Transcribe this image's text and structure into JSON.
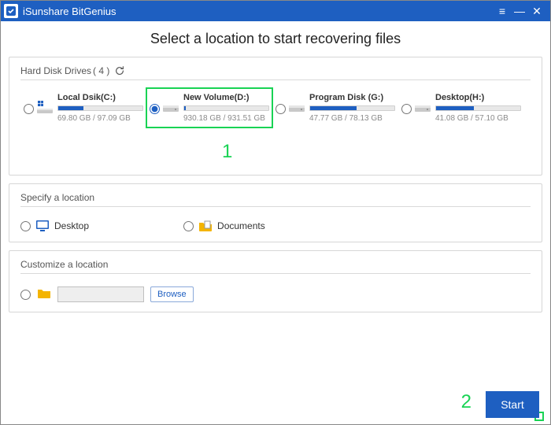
{
  "app": {
    "title": "iSunshare BitGenius"
  },
  "page": {
    "title": "Select a location to start recovering files"
  },
  "hdd": {
    "label": "Hard Disk Drives",
    "count_fmt": "( 4 )",
    "drives": [
      {
        "name": "Local Dsik(C:)",
        "size": "69.80 GB / 97.09 GB",
        "pct": 30,
        "selected": false,
        "os": true
      },
      {
        "name": "New Volume(D:)",
        "size": "930.18 GB / 931.51 GB",
        "pct": 2,
        "selected": true,
        "os": false
      },
      {
        "name": "Program Disk (G:)",
        "size": "47.77 GB / 78.13 GB",
        "pct": 55,
        "selected": false,
        "os": false
      },
      {
        "name": "Desktop(H:)",
        "size": "41.08 GB / 57.10 GB",
        "pct": 45,
        "selected": false,
        "os": false
      }
    ]
  },
  "specify": {
    "label": "Specify a location",
    "desktop": "Desktop",
    "documents": "Documents"
  },
  "customize": {
    "label": "Customize a location",
    "path": "",
    "browse": "Browse"
  },
  "actions": {
    "start": "Start"
  },
  "annotations": {
    "one": "1",
    "two": "2"
  }
}
